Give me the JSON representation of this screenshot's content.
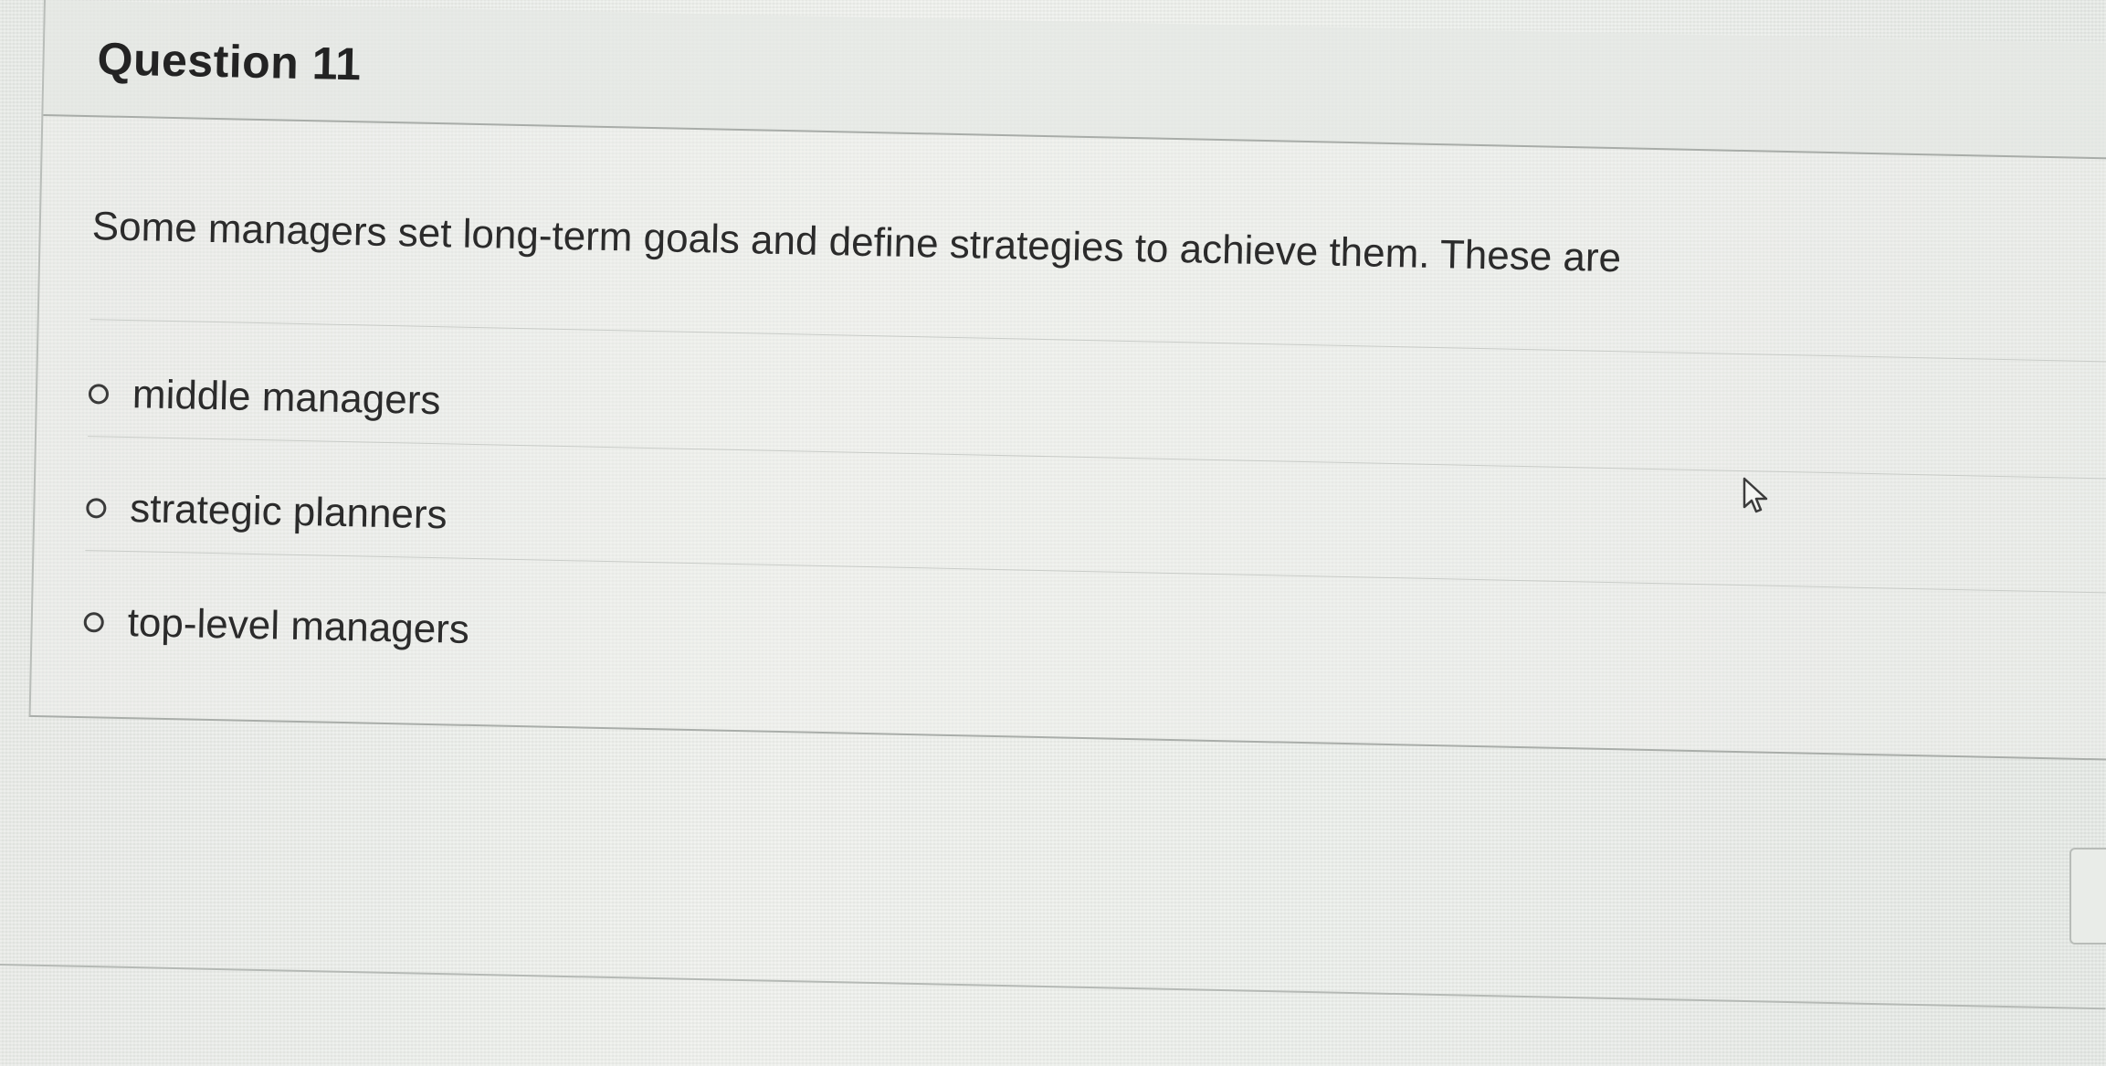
{
  "question": {
    "title": "Question 11",
    "text": "Some managers set long-term goals and define strategies to achieve them. These are",
    "options": [
      {
        "label": "middle managers"
      },
      {
        "label": "strategic planners"
      },
      {
        "label": "top-level managers"
      }
    ]
  },
  "icons": {
    "radio": "radio-unselected",
    "cursor": "mouse-pointer"
  }
}
